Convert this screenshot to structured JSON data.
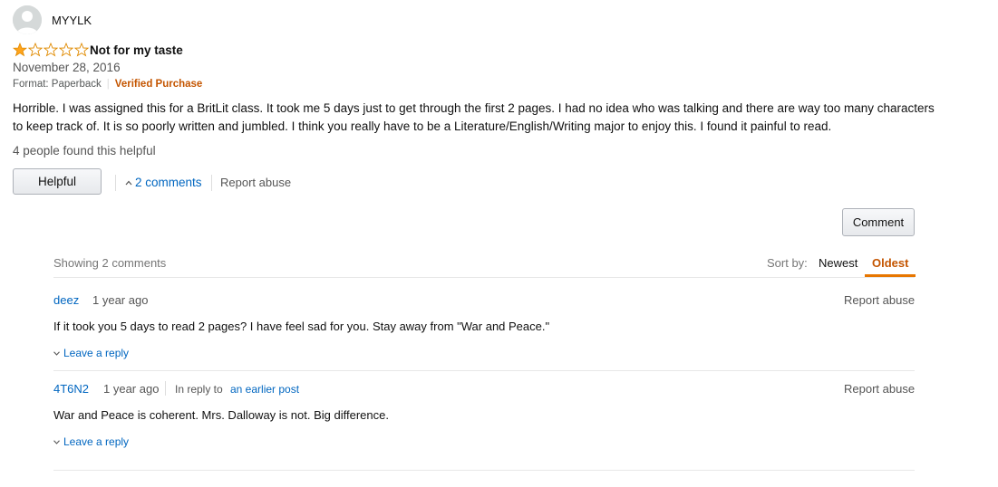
{
  "review": {
    "username": "MYYLK",
    "rating": 1,
    "rating_max": 5,
    "title": "Not for my taste",
    "date": "November 28, 2016",
    "format": "Format: Paperback",
    "verified": "Verified Purchase",
    "body": "Horrible. I was assigned this for a BritLit class. It took me 5 days just to get through the first 2 pages. I had no idea who was talking and there are way too many characters to keep track of. It is so poorly written and jumbled. I think you really have to be a Literature/English/Writing major to enjoy this. I found it painful to read.",
    "helpful_count": "4 people found this helpful",
    "helpful_button": "Helpful",
    "comments_link": "2 comments",
    "report_abuse": "Report abuse",
    "star_color": "#ffa41c"
  },
  "comments_section": {
    "comment_button": "Comment",
    "showing": "Showing 2 comments",
    "sort_label": "Sort by:",
    "sort_newest": "Newest",
    "sort_oldest": "Oldest",
    "selected_sort": "Oldest",
    "comments": [
      {
        "author": "deez",
        "time": "1 year ago",
        "text": "If it took you 5 days to read 2 pages? I have feel sad for you. Stay away from \"War and Peace.\"",
        "report": "Report abuse",
        "leave_reply": "Leave a reply"
      },
      {
        "author": "4T6N2",
        "time": "1 year ago",
        "in_reply_to": "In reply to",
        "earlier_post": "an earlier post",
        "text": "War and Peace is coherent. Mrs. Dalloway is not. Big difference.",
        "report": "Report abuse",
        "leave_reply": "Leave a reply"
      }
    ]
  }
}
